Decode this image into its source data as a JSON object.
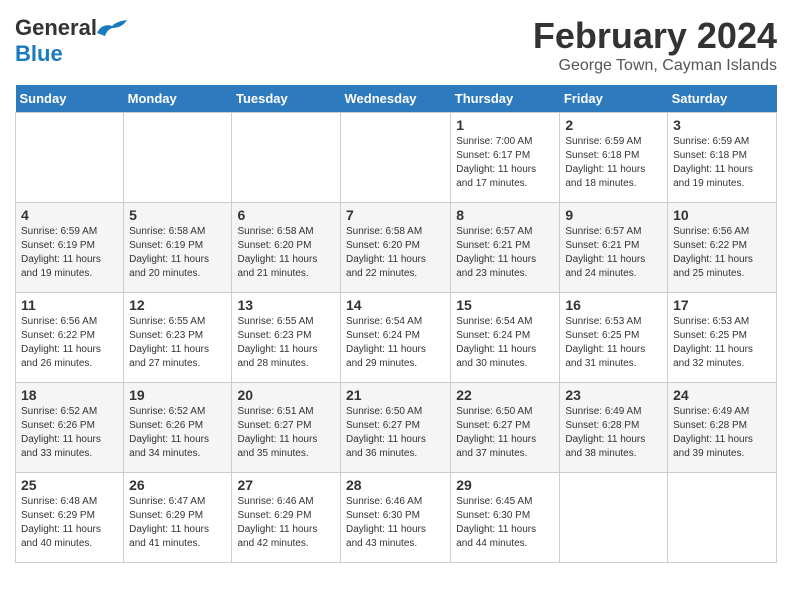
{
  "logo": {
    "general": "General",
    "blue": "Blue"
  },
  "title": "February 2024",
  "location": "George Town, Cayman Islands",
  "days_of_week": [
    "Sunday",
    "Monday",
    "Tuesday",
    "Wednesday",
    "Thursday",
    "Friday",
    "Saturday"
  ],
  "weeks": [
    [
      {
        "day": "",
        "info": ""
      },
      {
        "day": "",
        "info": ""
      },
      {
        "day": "",
        "info": ""
      },
      {
        "day": "",
        "info": ""
      },
      {
        "day": "1",
        "info": "Sunrise: 7:00 AM\nSunset: 6:17 PM\nDaylight: 11 hours and 17 minutes."
      },
      {
        "day": "2",
        "info": "Sunrise: 6:59 AM\nSunset: 6:18 PM\nDaylight: 11 hours and 18 minutes."
      },
      {
        "day": "3",
        "info": "Sunrise: 6:59 AM\nSunset: 6:18 PM\nDaylight: 11 hours and 19 minutes."
      }
    ],
    [
      {
        "day": "4",
        "info": "Sunrise: 6:59 AM\nSunset: 6:19 PM\nDaylight: 11 hours and 19 minutes."
      },
      {
        "day": "5",
        "info": "Sunrise: 6:58 AM\nSunset: 6:19 PM\nDaylight: 11 hours and 20 minutes."
      },
      {
        "day": "6",
        "info": "Sunrise: 6:58 AM\nSunset: 6:20 PM\nDaylight: 11 hours and 21 minutes."
      },
      {
        "day": "7",
        "info": "Sunrise: 6:58 AM\nSunset: 6:20 PM\nDaylight: 11 hours and 22 minutes."
      },
      {
        "day": "8",
        "info": "Sunrise: 6:57 AM\nSunset: 6:21 PM\nDaylight: 11 hours and 23 minutes."
      },
      {
        "day": "9",
        "info": "Sunrise: 6:57 AM\nSunset: 6:21 PM\nDaylight: 11 hours and 24 minutes."
      },
      {
        "day": "10",
        "info": "Sunrise: 6:56 AM\nSunset: 6:22 PM\nDaylight: 11 hours and 25 minutes."
      }
    ],
    [
      {
        "day": "11",
        "info": "Sunrise: 6:56 AM\nSunset: 6:22 PM\nDaylight: 11 hours and 26 minutes."
      },
      {
        "day": "12",
        "info": "Sunrise: 6:55 AM\nSunset: 6:23 PM\nDaylight: 11 hours and 27 minutes."
      },
      {
        "day": "13",
        "info": "Sunrise: 6:55 AM\nSunset: 6:23 PM\nDaylight: 11 hours and 28 minutes."
      },
      {
        "day": "14",
        "info": "Sunrise: 6:54 AM\nSunset: 6:24 PM\nDaylight: 11 hours and 29 minutes."
      },
      {
        "day": "15",
        "info": "Sunrise: 6:54 AM\nSunset: 6:24 PM\nDaylight: 11 hours and 30 minutes."
      },
      {
        "day": "16",
        "info": "Sunrise: 6:53 AM\nSunset: 6:25 PM\nDaylight: 11 hours and 31 minutes."
      },
      {
        "day": "17",
        "info": "Sunrise: 6:53 AM\nSunset: 6:25 PM\nDaylight: 11 hours and 32 minutes."
      }
    ],
    [
      {
        "day": "18",
        "info": "Sunrise: 6:52 AM\nSunset: 6:26 PM\nDaylight: 11 hours and 33 minutes."
      },
      {
        "day": "19",
        "info": "Sunrise: 6:52 AM\nSunset: 6:26 PM\nDaylight: 11 hours and 34 minutes."
      },
      {
        "day": "20",
        "info": "Sunrise: 6:51 AM\nSunset: 6:27 PM\nDaylight: 11 hours and 35 minutes."
      },
      {
        "day": "21",
        "info": "Sunrise: 6:50 AM\nSunset: 6:27 PM\nDaylight: 11 hours and 36 minutes."
      },
      {
        "day": "22",
        "info": "Sunrise: 6:50 AM\nSunset: 6:27 PM\nDaylight: 11 hours and 37 minutes."
      },
      {
        "day": "23",
        "info": "Sunrise: 6:49 AM\nSunset: 6:28 PM\nDaylight: 11 hours and 38 minutes."
      },
      {
        "day": "24",
        "info": "Sunrise: 6:49 AM\nSunset: 6:28 PM\nDaylight: 11 hours and 39 minutes."
      }
    ],
    [
      {
        "day": "25",
        "info": "Sunrise: 6:48 AM\nSunset: 6:29 PM\nDaylight: 11 hours and 40 minutes."
      },
      {
        "day": "26",
        "info": "Sunrise: 6:47 AM\nSunset: 6:29 PM\nDaylight: 11 hours and 41 minutes."
      },
      {
        "day": "27",
        "info": "Sunrise: 6:46 AM\nSunset: 6:29 PM\nDaylight: 11 hours and 42 minutes."
      },
      {
        "day": "28",
        "info": "Sunrise: 6:46 AM\nSunset: 6:30 PM\nDaylight: 11 hours and 43 minutes."
      },
      {
        "day": "29",
        "info": "Sunrise: 6:45 AM\nSunset: 6:30 PM\nDaylight: 11 hours and 44 minutes."
      },
      {
        "day": "",
        "info": ""
      },
      {
        "day": "",
        "info": ""
      }
    ]
  ]
}
